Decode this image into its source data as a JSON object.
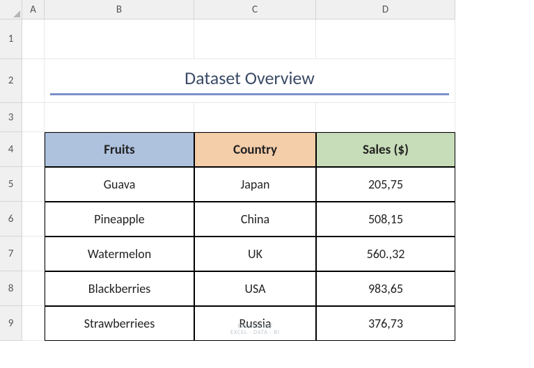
{
  "columns": [
    "A",
    "B",
    "C",
    "D"
  ],
  "rows": [
    "1",
    "2",
    "3",
    "4",
    "5",
    "6",
    "7",
    "8",
    "9"
  ],
  "title": "Dataset Overview",
  "headers": {
    "fruits": "Fruits",
    "country": "Country",
    "sales": "Sales ($)"
  },
  "data": [
    {
      "fruit": "Guava",
      "country": "Japan",
      "sales": "205,75"
    },
    {
      "fruit": "Pineapple",
      "country": "China",
      "sales": "508,15"
    },
    {
      "fruit": "Watermelon",
      "country": "UK",
      "sales": "560.,32"
    },
    {
      "fruit": "Blackberries",
      "country": "USA",
      "sales": "983,65"
    },
    {
      "fruit": "Strawberriees",
      "country": "Russia",
      "sales": "376,73"
    }
  ],
  "watermark": {
    "brand": "exceldemy",
    "tagline": "EXCEL · DATA · BI"
  }
}
